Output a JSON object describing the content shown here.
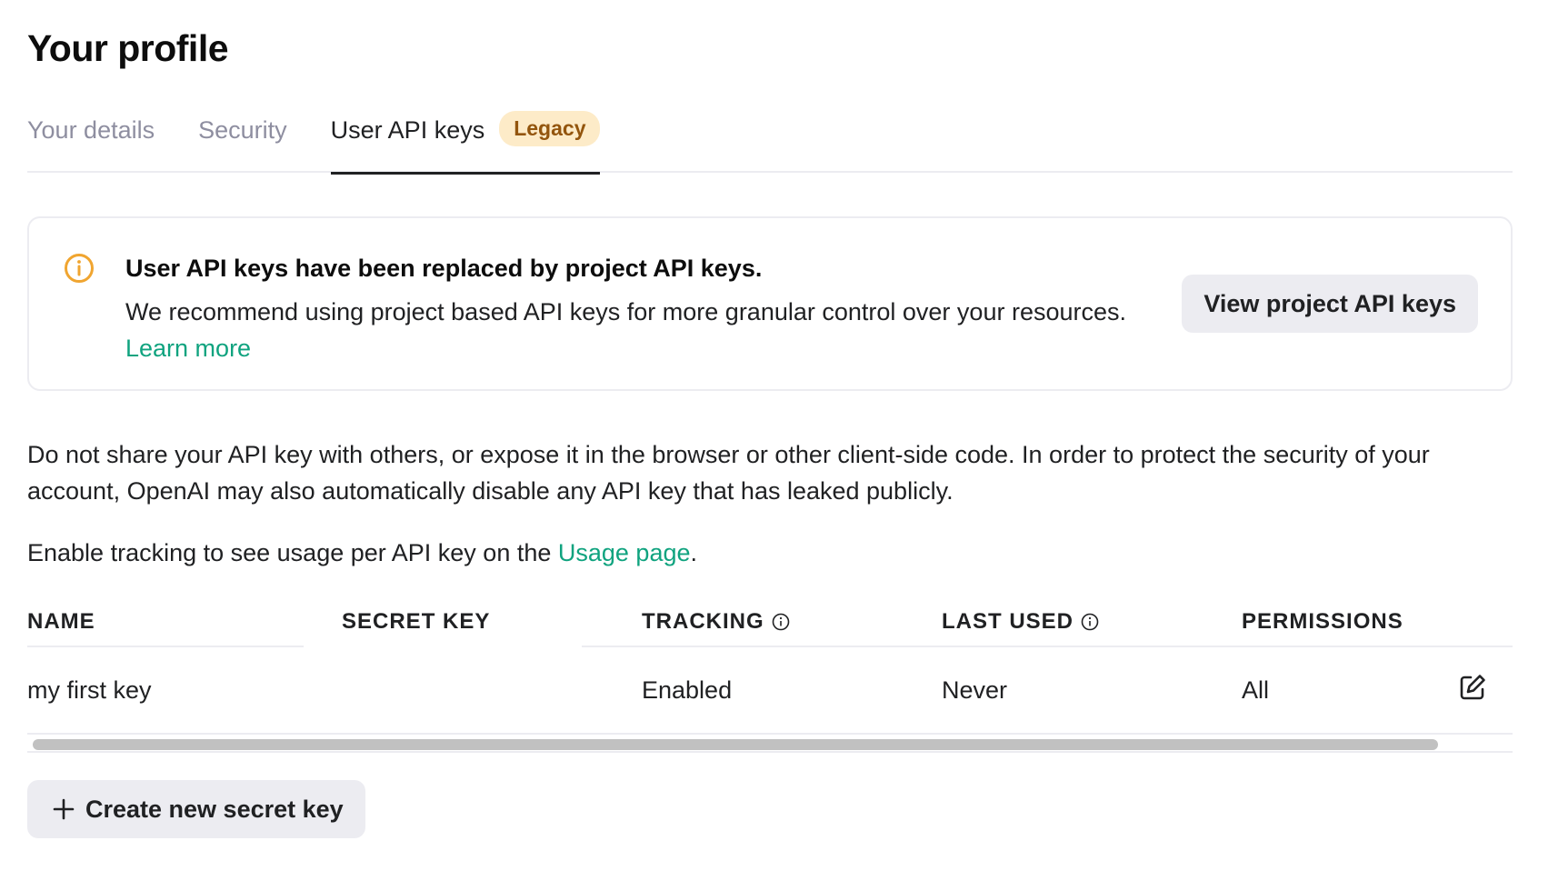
{
  "page": {
    "title": "Your profile"
  },
  "tabs": [
    {
      "label": "Your details",
      "active": false
    },
    {
      "label": "Security",
      "active": false
    },
    {
      "label": "User API keys",
      "active": true,
      "badge": "Legacy"
    }
  ],
  "notice": {
    "icon": "info-circle-icon",
    "heading": "User API keys have been replaced by project API keys.",
    "body": "We recommend using project based API keys for more granular control over your resources.",
    "link": "Learn more",
    "button": "View project API keys"
  },
  "warning_text": "Do not share your API key with others, or expose it in the browser or other client-side code. In order to protect the security of your account, OpenAI may also automatically disable any API key that has leaked publicly.",
  "tracking_text": {
    "before": "Enable tracking to see usage per API key on the ",
    "link": "Usage page",
    "after": "."
  },
  "table": {
    "headers": [
      "NAME",
      "SECRET KEY",
      "TRACKING",
      "LAST USED",
      "PERMISSIONS"
    ],
    "rows": [
      {
        "name": "my first key",
        "secret_key": "",
        "tracking": "Enabled",
        "last_used": "Never",
        "permissions": "All"
      }
    ]
  },
  "create_button": "Create new secret key",
  "colors": {
    "accent": "#10a37f",
    "badge_bg": "#fdebc8",
    "badge_text": "#93550d",
    "info_icon": "#f0a530"
  }
}
